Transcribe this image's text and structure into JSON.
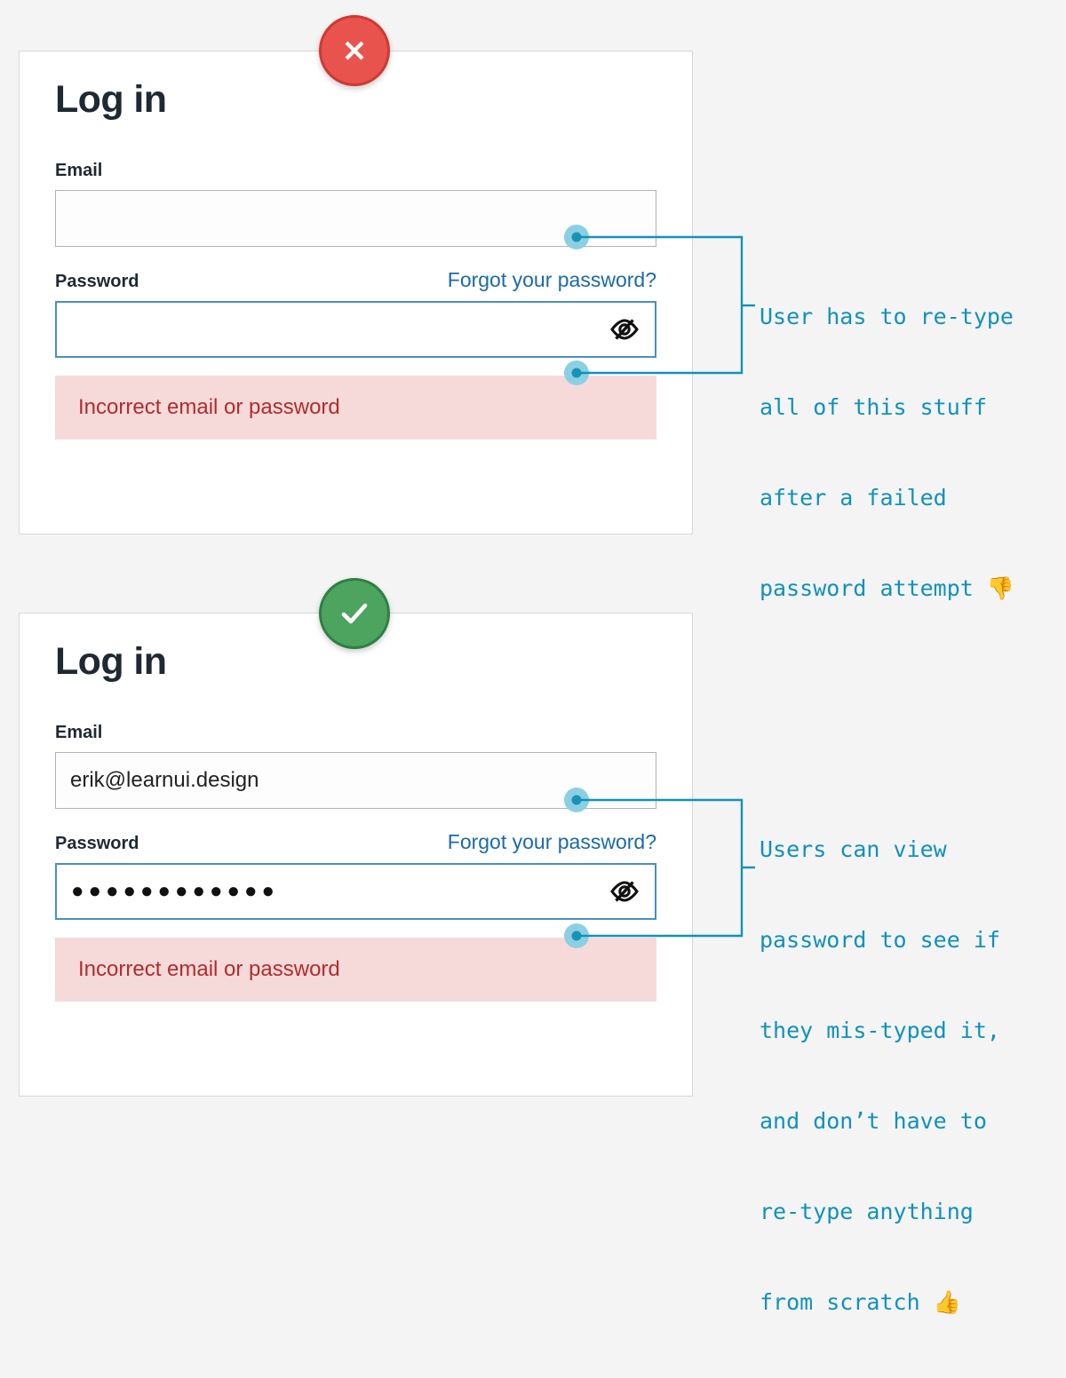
{
  "page": {
    "background_color": "#f4f4f4",
    "accent_teal": "#1191bb",
    "link_blue": "#1a6aa8",
    "error_bg": "#f6dada",
    "error_text_color": "#b12c2c",
    "heading_color": "#1f2933"
  },
  "cards": [
    {
      "id": "invalid",
      "badge": {
        "name": "fail-badge",
        "glyph": "✕",
        "fill": "#e8534e",
        "ring": "#d03832"
      },
      "title": "Log in",
      "email": {
        "label": "Email",
        "value": "",
        "placeholder": ""
      },
      "password": {
        "label": "Password",
        "forgot_label": "Forgot your password?",
        "value": "",
        "masked_display": "",
        "reveal_icon": "eye-off-icon"
      },
      "error": {
        "message": "Incorrect email or password"
      }
    },
    {
      "id": "valid",
      "badge": {
        "name": "success-badge",
        "glyph": "✓",
        "fill": "#4ca45f",
        "ring": "#2f7f42"
      },
      "title": "Log in",
      "email": {
        "label": "Email",
        "value": "erik@learnui.design",
        "placeholder": ""
      },
      "password": {
        "label": "Password",
        "forgot_label": "Forgot your password?",
        "value": "",
        "masked_display": "●●●●●●●●●●●●",
        "reveal_icon": "eye-off-icon"
      },
      "error": {
        "message": "Incorrect email or password"
      }
    }
  ],
  "annotations": [
    {
      "id": "annotation-1",
      "lines": [
        "User has to re-type",
        "all of this stuff",
        "after a failed",
        "password attempt "
      ],
      "emoji": "👎",
      "color": "#1191bb"
    },
    {
      "id": "annotation-2",
      "lines": [
        "Users can view",
        "password to see if",
        "they mis-typed it,",
        "and don’t have to",
        "re-type anything",
        "from scratch "
      ],
      "emoji": "👍",
      "color": "#1191bb"
    }
  ]
}
